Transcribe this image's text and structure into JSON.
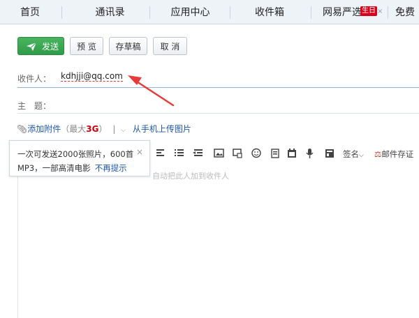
{
  "nav": {
    "tabs": [
      "首页",
      "通讯录",
      "应用中心",
      "收件箱",
      "网易严选",
      "免费"
    ],
    "badge": "生日",
    "close": "×"
  },
  "toolbar": {
    "send": "发送",
    "preview": "预 览",
    "draft": "存草稿",
    "cancel": "取 消"
  },
  "compose": {
    "to_label": "收件人：",
    "to_value": "kdhjji@qq.com",
    "subject_label": "主　题："
  },
  "attach": {
    "add": "添加附件",
    "limit_prefix": "（最大",
    "limit_value": "3G",
    "limit_suffix": "）",
    "divider": "|",
    "mobile": "从手机上传图片"
  },
  "editor": {
    "signature": "签名",
    "receipt": "邮件存证",
    "placeholder": "自动把此人加到收件人"
  },
  "tooltip": {
    "line1": "一次可发送2000张照片，600首",
    "line2": "MP3，一部高清电影",
    "dismiss": "不再提示"
  },
  "colors": {
    "send_green": "#3aa653",
    "link_blue": "#1d57a5",
    "annotation_red": "#e53b3b"
  }
}
